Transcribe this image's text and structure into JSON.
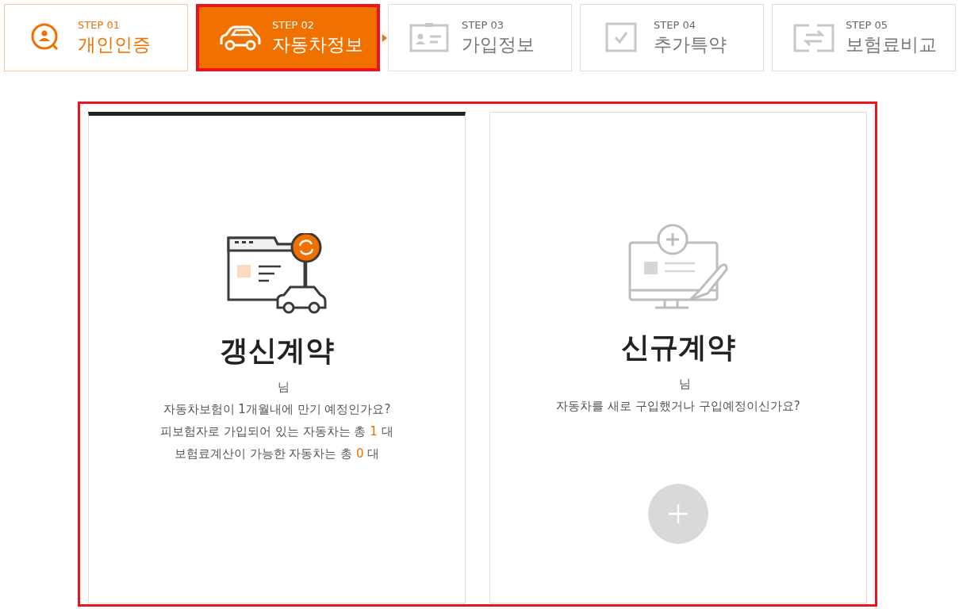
{
  "steps": [
    {
      "label": "STEP 01",
      "title": "개인인증",
      "done": true,
      "selected": false
    },
    {
      "label": "STEP 02",
      "title": "자동차정보",
      "done": false,
      "selected": true
    },
    {
      "label": "STEP 03",
      "title": "가입정보",
      "done": false,
      "selected": false
    },
    {
      "label": "STEP 04",
      "title": "추가특약",
      "done": false,
      "selected": false
    },
    {
      "label": "STEP 05",
      "title": "보험료비교",
      "done": false,
      "selected": false
    }
  ],
  "highlight": true,
  "cards": [
    {
      "kind": "renewal",
      "selected": true,
      "title": "갱신계약",
      "greeting": "님",
      "add_button": false,
      "lines": [
        {
          "text": "자동차보험이 1개월내에 만기 예정인가요?"
        },
        {
          "text": "피보험자로 가입되어 있는 자동차는 총",
          "count": "1",
          "unit": "대"
        },
        {
          "text": "보험료계산이 가능한 자동차는 총",
          "count": "0",
          "unit": "대"
        }
      ]
    },
    {
      "kind": "new",
      "selected": false,
      "title": "신규계약",
      "greeting": "님",
      "add_button": true,
      "lines": [
        {
          "text": "자동차를 새로 구입했거나 구입예정이신가요?"
        }
      ]
    }
  ]
}
